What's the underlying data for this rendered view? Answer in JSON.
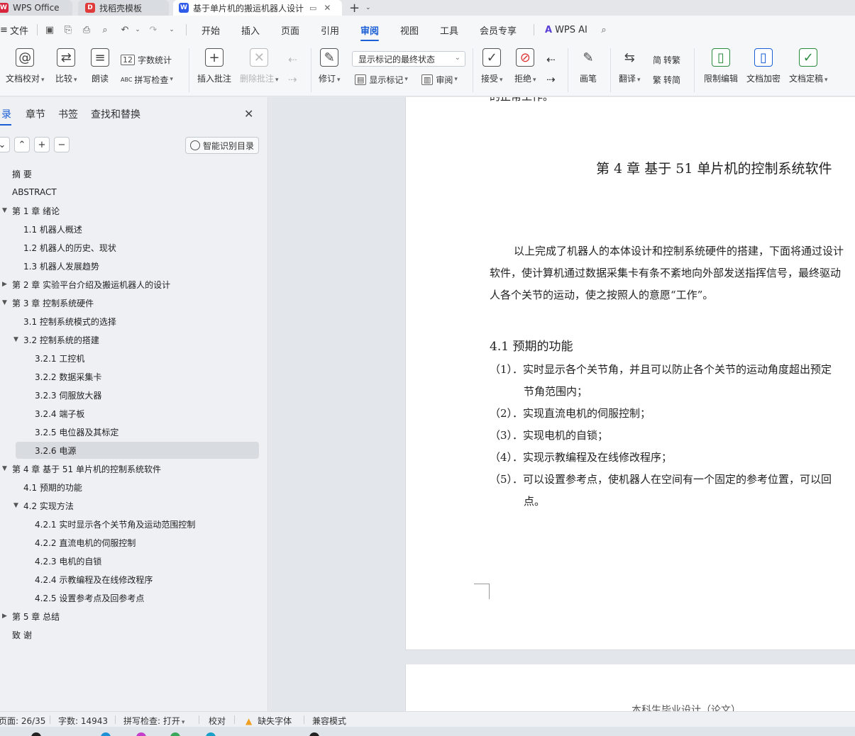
{
  "tabs": [
    {
      "label": "WPS Office",
      "icon": "wps-logo-icon",
      "color": "#d7263d"
    },
    {
      "label": "找稻壳模板",
      "icon": "docer-icon",
      "color": "#e03a3a"
    },
    {
      "label": "基于单片机的搬运机器人设计",
      "icon": "word-doc-icon",
      "color": "#2f5bea"
    }
  ],
  "menu": {
    "file": "文件",
    "items": [
      "开始",
      "插入",
      "页面",
      "引用",
      "审阅",
      "视图",
      "工具",
      "会员专享"
    ],
    "active": "审阅",
    "wps_ai": "WPS AI"
  },
  "ribbon": {
    "doc_proof": "文档校对",
    "compare": "比较",
    "read_aloud": "朗读",
    "word_count": "字数统计",
    "spell_check": "拼写检查",
    "insert_comment": "插入批注",
    "delete_comment": "删除批注",
    "track_changes": "修订",
    "markup_state": "显示标记的最终状态",
    "show_markup": "显示标记",
    "review": "审阅",
    "accept": "接受",
    "reject": "拒绝",
    "pen": "画笔",
    "translate": "翻译",
    "to_traditional": "转繁",
    "to_simplified": "转简",
    "restrict_edit": "限制编辑",
    "doc_encrypt": "文档加密",
    "doc_finalize": "文档定稿"
  },
  "nav": {
    "tabs": [
      "目录",
      "章节",
      "书签",
      "查找和替换"
    ],
    "smart_toc": "智能识别目录",
    "toc": [
      {
        "label": "摘  要",
        "level": 1,
        "arrow": ""
      },
      {
        "label": "ABSTRACT",
        "level": 1,
        "arrow": ""
      },
      {
        "label": "第 1 章  绪论",
        "level": 1,
        "arrow": "down"
      },
      {
        "label": "1.1  机器人概述",
        "level": 2,
        "arrow": ""
      },
      {
        "label": "1.2  机器人的历史、现状",
        "level": 2,
        "arrow": ""
      },
      {
        "label": "1.3  机器人发展趋势",
        "level": 2,
        "arrow": ""
      },
      {
        "label": "第 2 章  实验平台介绍及搬运机器人的设计",
        "level": 1,
        "arrow": "right"
      },
      {
        "label": "第 3 章  控制系统硬件",
        "level": 1,
        "arrow": "down"
      },
      {
        "label": "3.1  控制系统模式的选择",
        "level": 2,
        "arrow": ""
      },
      {
        "label": "3.2 控制系统的搭建",
        "level": 2,
        "arrow": "down"
      },
      {
        "label": "3.2.1 工控机",
        "level": 3,
        "arrow": ""
      },
      {
        "label": "3.2.2 数据采集卡",
        "level": 3,
        "arrow": ""
      },
      {
        "label": "3.2.3 伺服放大器",
        "level": 3,
        "arrow": ""
      },
      {
        "label": "3.2.4 端子板",
        "level": 3,
        "arrow": ""
      },
      {
        "label": "3.2.5 电位器及其标定",
        "level": 3,
        "arrow": ""
      },
      {
        "label": "3.2.6 电源",
        "level": 3,
        "arrow": "",
        "selected": true
      },
      {
        "label": "第 4 章  基于 51 单片机的控制系统软件",
        "level": 1,
        "arrow": "down"
      },
      {
        "label": "4.1 预期的功能",
        "level": 2,
        "arrow": ""
      },
      {
        "label": "4.2  实现方法",
        "level": 2,
        "arrow": "down"
      },
      {
        "label": "4.2.1 实时显示各个关节角及运动范围控制",
        "level": 3,
        "arrow": ""
      },
      {
        "label": "4.2.2 直流电机的伺服控制",
        "level": 3,
        "arrow": ""
      },
      {
        "label": "4.2.3 电机的自锁",
        "level": 3,
        "arrow": ""
      },
      {
        "label": "4.2.4 示教编程及在线修改程序",
        "level": 3,
        "arrow": ""
      },
      {
        "label": "4.2.5 设置参考点及回参考点",
        "level": 3,
        "arrow": ""
      },
      {
        "label": "第 5 章  总结",
        "level": 1,
        "arrow": "right"
      },
      {
        "label": "致  谢",
        "level": 1,
        "arrow": ""
      }
    ]
  },
  "doc": {
    "top_cut": "的正常工作。",
    "chapter_title": "第 4 章  基于 51 单片机的控制系统软件",
    "para": [
      "以上完成了机器人的本体设计和控制系统硬件的搭建，下面将通过设计",
      "软件，使计算机通过数据采集卡有条不紊地向外部发送指挥信号，最终驱动",
      "人各个关节的运动，使之按照人的意愿“工作”。"
    ],
    "section_title": "4.1 预期的功能",
    "list": [
      "（1）．实时显示各个关节角，并且可以防止各个关节的运动角度超出预定",
      "节角范围内；",
      "（2）．实现直流电机的伺服控制；",
      "（3）．实现电机的自锁；",
      "（4）．实现示教编程及在线修改程序；",
      "（5）．可以设置参考点，使机器人在空间有一个固定的参考位置，可以回",
      "点。"
    ],
    "page2_header": "本科生毕业设计（论文）"
  },
  "status": {
    "page": "页面: 26/35",
    "words": "字数: 14943",
    "spell": "拼写检查: 打开",
    "proof": "校对",
    "missing_font": "缺失字体",
    "compat": "兼容模式"
  },
  "colors": {
    "accent": "#1a5fd6",
    "warning": "#f0a020"
  }
}
